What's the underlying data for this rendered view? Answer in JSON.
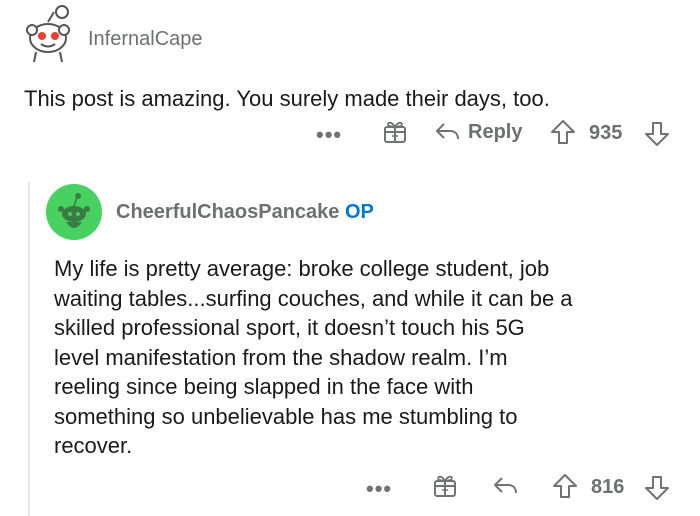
{
  "comments": [
    {
      "username": "InfernalCape",
      "body": "This post is amazing. You surely made their days, too.",
      "actions": {
        "more": "•••",
        "reply_label": "Reply",
        "score": "935"
      }
    },
    {
      "username": "CheerfulChaosPancake",
      "badge": "OP",
      "body_lines": [
        "My life is pretty average: broke college student, job",
        "waiting tables...surfing couches, and while it can be a",
        "skilled professional sport, it doesn’t touch his 5G",
        "level manifestation from the shadow realm. I’m",
        "reeling since being slapped in the face with",
        "something so unbelievable has me stumbling to",
        "recover."
      ],
      "actions": {
        "more": "•••",
        "score": "816"
      }
    }
  ],
  "colors": {
    "accent_blue": "#0079d3",
    "avatar_green": "#46d160",
    "muted": "#707274"
  },
  "icons": [
    "snoo-avatar-icon",
    "gift-icon",
    "reply-arrow-icon",
    "upvote-icon",
    "downvote-icon"
  ]
}
